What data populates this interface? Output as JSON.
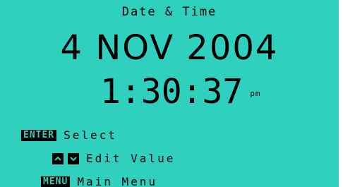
{
  "screen": {
    "title": "Date & Time",
    "date": "4 NOV 2004",
    "time": "1:30:37",
    "ampm": "pm"
  },
  "help": {
    "enter_key": "ENTER",
    "enter_label": "Select",
    "arrows_label": "Edit Value",
    "menu_key": "MENU",
    "menu_label": "Main Menu"
  },
  "colors": {
    "lcd_background": "#2fd0bd",
    "lcd_text": "#000000"
  },
  "icons": {
    "up": "up-arrow-icon",
    "down": "down-arrow-icon"
  }
}
